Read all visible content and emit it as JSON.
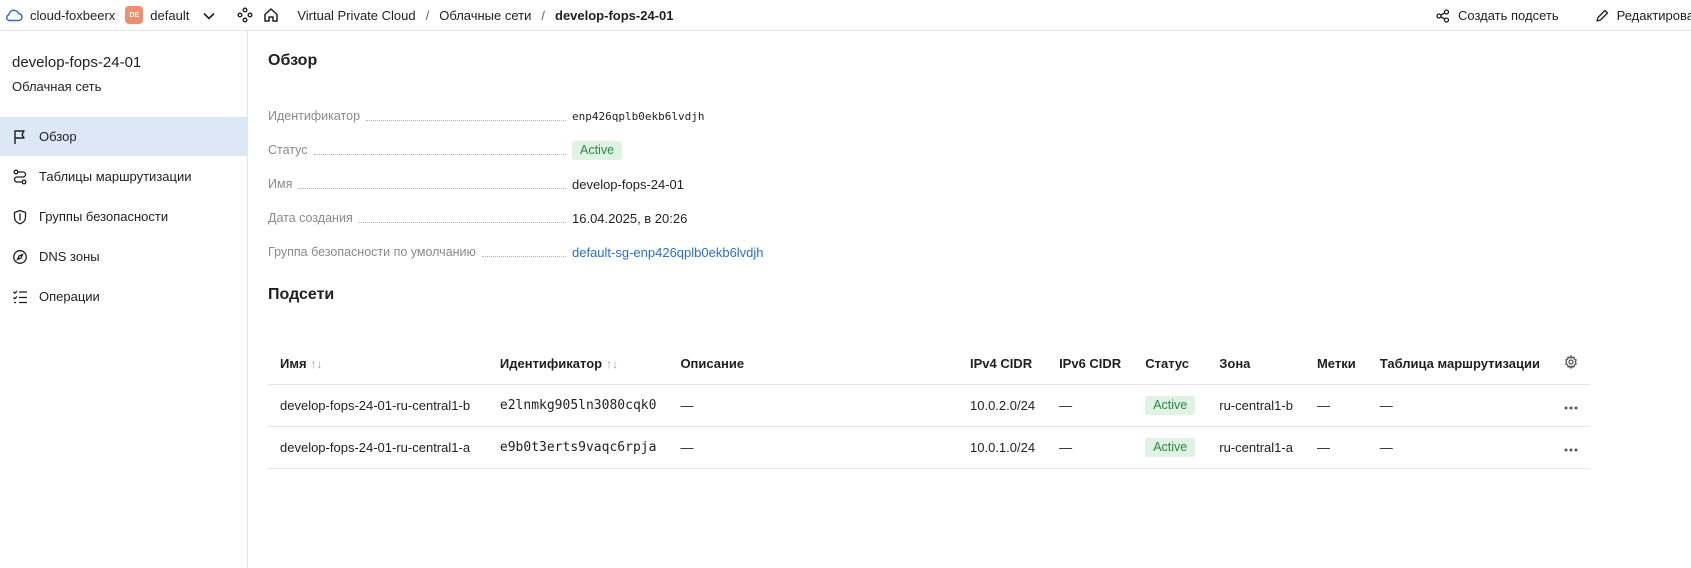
{
  "topbar": {
    "cloud_name": "cloud-foxbeerx",
    "folder_badge": "DE",
    "folder_name": "default",
    "breadcrumbs": [
      "Virtual Private Cloud",
      "Облачные сети",
      "develop-fops-24-01"
    ],
    "breadcrumb_separator": "/",
    "create_subnet_label": "Создать подсеть",
    "edit_label": "Редактировать"
  },
  "sidebar": {
    "title": "develop-fops-24-01",
    "subtitle": "Облачная сеть",
    "items": [
      {
        "label": "Обзор",
        "icon": "flag-icon",
        "active": true
      },
      {
        "label": "Таблицы маршрутизации",
        "icon": "route-icon",
        "active": false
      },
      {
        "label": "Группы безопасности",
        "icon": "shield-icon",
        "active": false
      },
      {
        "label": "DNS зоны",
        "icon": "compass-icon",
        "active": false
      },
      {
        "label": "Операции",
        "icon": "list-icon",
        "active": false
      }
    ]
  },
  "overview": {
    "heading": "Обзор",
    "props": [
      {
        "label": "Идентификатор",
        "value": "enp426qplb0ekb6lvdjh"
      },
      {
        "label": "Статус",
        "value": "Active"
      },
      {
        "label": "Имя",
        "value": "develop-fops-24-01"
      },
      {
        "label": "Дата создания",
        "value": "16.04.2025, в 20:26"
      },
      {
        "label": "Группа безопасности по умолчанию",
        "value": "default-sg-enp426qplb0ekb6lvdjh"
      }
    ]
  },
  "subnets": {
    "heading": "Подсети",
    "columns": [
      "Имя",
      "Идентификатор",
      "Описание",
      "IPv4 CIDR",
      "IPv6 CIDR",
      "Статус",
      "Зона",
      "Метки",
      "Таблица маршрутизации"
    ],
    "sort_glyph": "↑↓",
    "rows": [
      {
        "name": "develop-fops-24-01-ru-central1-b",
        "id": "e2lnmkg905ln3080cqk0",
        "description": "—",
        "ipv4": "10.0.2.0/24",
        "ipv6": "—",
        "status": "Active",
        "zone": "ru-central1-b",
        "labels": "—",
        "route_table": "—"
      },
      {
        "name": "develop-fops-24-01-ru-central1-a",
        "id": "e9b0t3erts9vaqc6rpja",
        "description": "—",
        "ipv4": "10.0.1.0/24",
        "ipv6": "—",
        "status": "Active",
        "zone": "ru-central1-a",
        "labels": "—",
        "route_table": "—"
      }
    ]
  },
  "colors": {
    "accent": "#2a6fc9",
    "active_nav_bg": "#dde8f7",
    "status_bg": "#dff2e4",
    "status_fg": "#2a8a3e",
    "folder_badge": "#f0906a"
  }
}
